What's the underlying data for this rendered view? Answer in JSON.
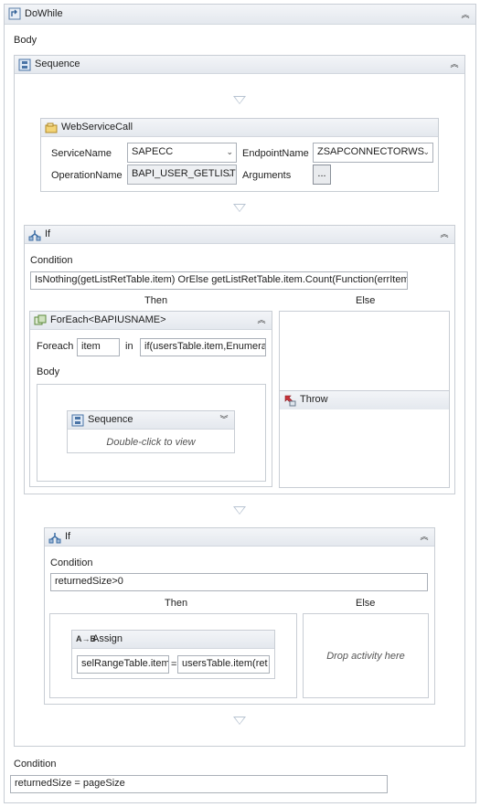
{
  "dowhile": {
    "title": "DoWhile",
    "body_label": "Body",
    "condition_label": "Condition",
    "condition_value": "returnedSize = pageSize"
  },
  "sequence": {
    "title": "Sequence"
  },
  "webservice": {
    "title": "WebServiceCall",
    "service_label": "ServiceName",
    "service_value": "SAPECC",
    "endpoint_label": "EndpointName",
    "endpoint_value": "ZSAPCONNECTORWS",
    "operation_label": "OperationName",
    "operation_value": "BAPI_USER_GETLIST",
    "arguments_label": "Arguments",
    "arguments_button": "..."
  },
  "if1": {
    "title": "If",
    "condition_label": "Condition",
    "condition_value": "IsNothing(getListRetTable.item) OrElse  getListRetTable.item.Count(Function(errItem",
    "then_label": "Then",
    "else_label": "Else",
    "foreach": {
      "title": "ForEach<BAPIUSNAME>",
      "foreach_label": "Foreach",
      "item_value": "item",
      "in_label": "in",
      "in_value": "if(usersTable.item,Enumera",
      "body_label": "Body",
      "sequence_title": "Sequence",
      "sequence_hint": "Double-click to view"
    },
    "throw_title": "Throw"
  },
  "if2": {
    "title": "If",
    "condition_label": "Condition",
    "condition_value": "returnedSize>0",
    "then_label": "Then",
    "else_label": "Else",
    "assign": {
      "title": "Assign",
      "to_value": "selRangeTable.item",
      "eq": "=",
      "value_value": "usersTable.item(ret"
    },
    "drop_hint": "Drop activity here"
  },
  "icons": {
    "dowhile": "dowhile-icon",
    "sequence": "sequence-icon",
    "webservice": "webservice-icon",
    "if": "if-icon",
    "foreach": "foreach-icon",
    "throw": "throw-icon",
    "assign": "assign-icon"
  }
}
